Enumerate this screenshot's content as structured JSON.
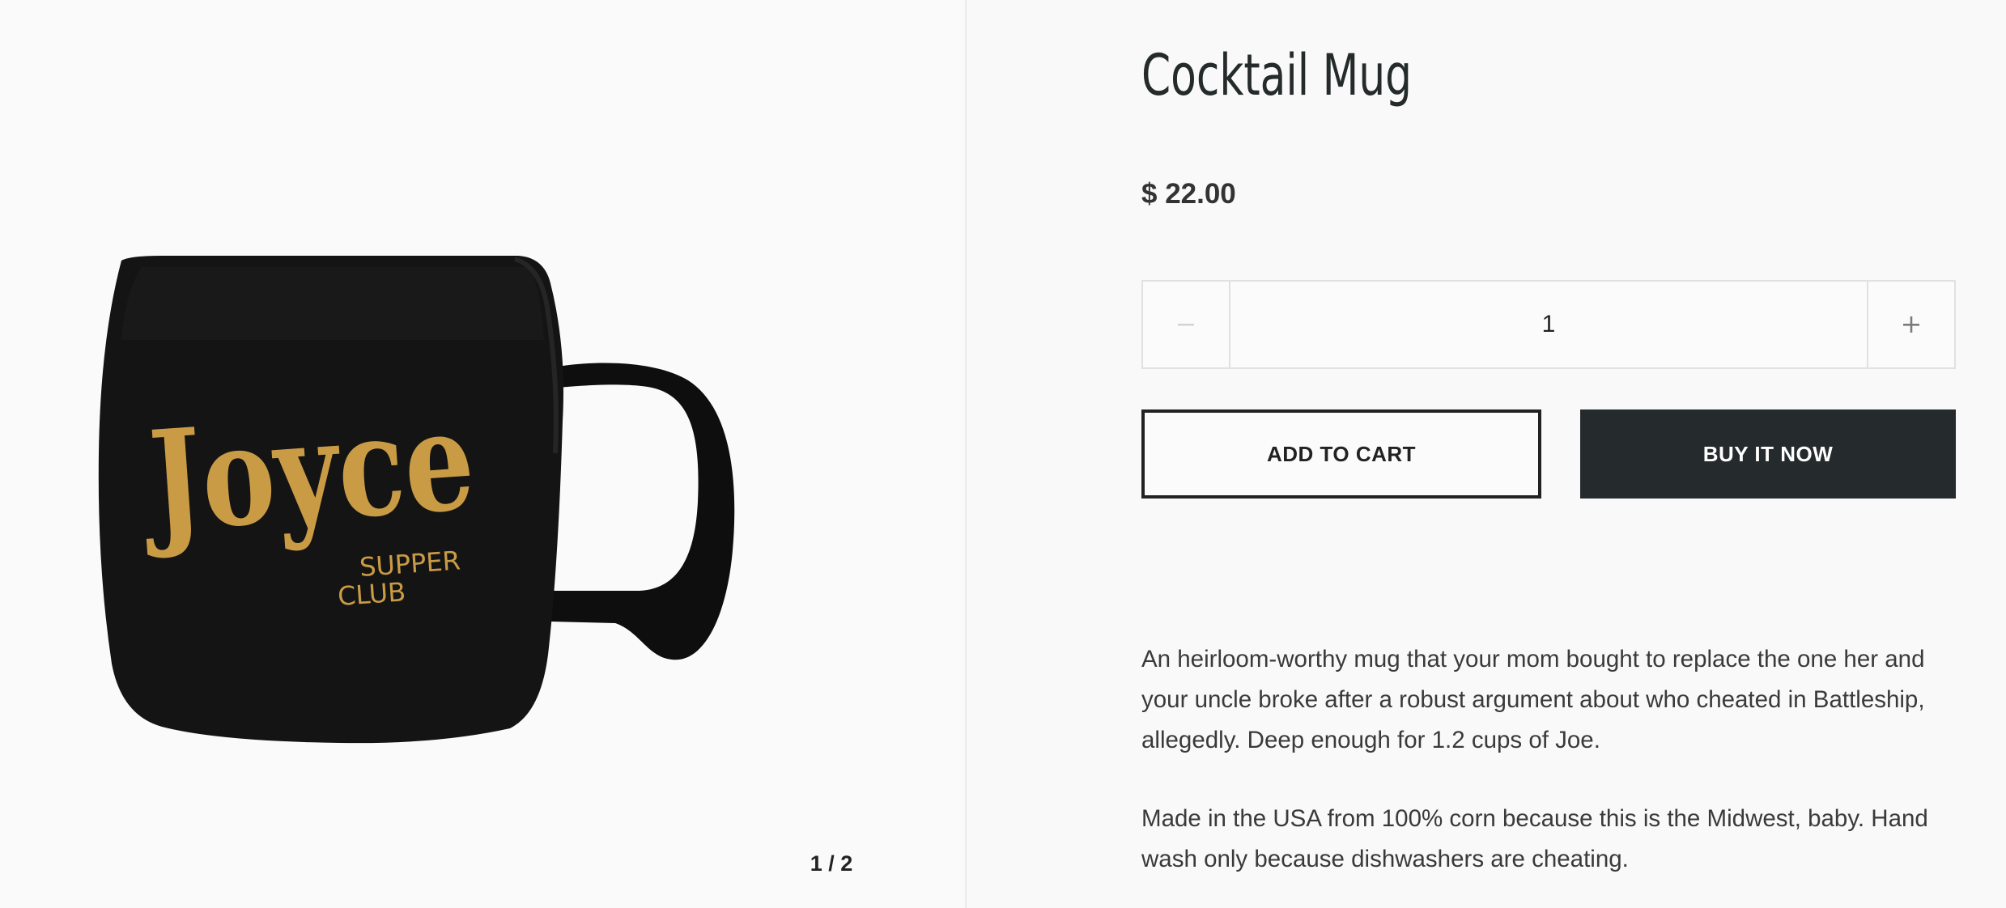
{
  "gallery": {
    "counter": "1 / 2",
    "image": {
      "logo_text": "Joyce",
      "logo_subtext_line1": "SUPPER",
      "logo_subtext_line2": "CLUB",
      "mug_color": "#141414",
      "logo_color": "#c99b45"
    }
  },
  "product": {
    "title": "Cocktail Mug",
    "price": "$ 22.00",
    "quantity": "1",
    "add_to_cart_label": "ADD TO CART",
    "buy_now_label": "BUY IT NOW",
    "description": [
      "An heirloom-worthy mug that your mom bought to replace the one her and your uncle broke after a robust argument about who cheated in Battleship, allegedly.  Deep enough for 1.2 cups of Joe.",
      "Made in the USA from 100% corn because this is the Midwest, baby. Hand wash only because dishwashers are cheating."
    ]
  },
  "icons": {
    "minus": "minus-icon",
    "plus": "plus-icon"
  },
  "colors": {
    "background": "#f9f9f9",
    "button_dark": "#252b2c",
    "text": "#2b2f30",
    "border": "#e1e1e1"
  }
}
